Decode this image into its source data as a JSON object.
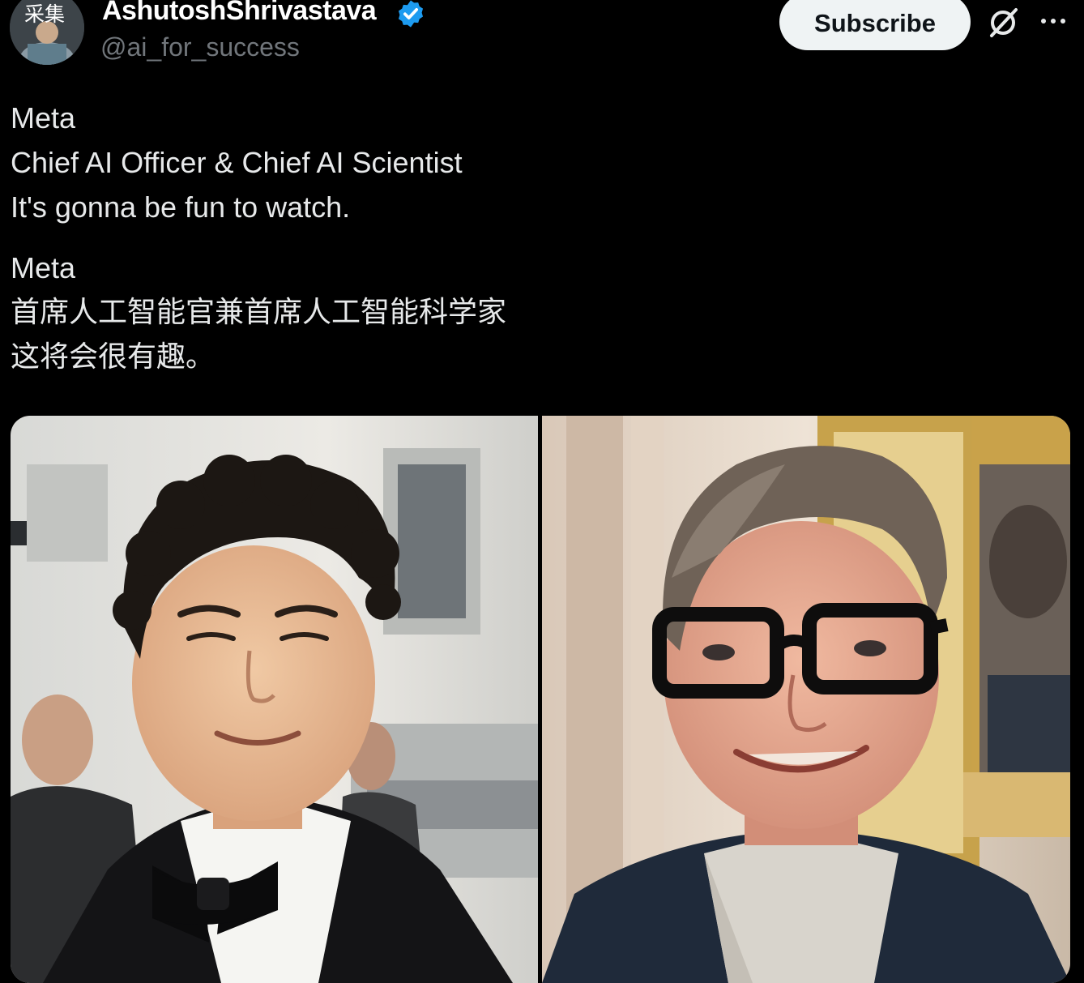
{
  "author": {
    "avatar_badge": "采集",
    "display_name": "AshutoshShrivastava",
    "handle": "@ai_for_success",
    "verified": true
  },
  "actions": {
    "subscribe_label": "Subscribe",
    "grok_icon": "grok-slash-icon",
    "more_icon": "more-dots-icon"
  },
  "tweet": {
    "paragraphs": [
      [
        "Meta",
        "Chief AI Officer & Chief AI Scientist",
        "It's gonna be fun to watch."
      ],
      [
        "Meta",
        "首席人工智能官兼首席人工智能科学家",
        "这将会很有趣。"
      ]
    ]
  },
  "media": {
    "images": [
      "young-man-tuxedo-bowtie-photo",
      "man-black-glasses-gold-frame-photo"
    ]
  },
  "colors": {
    "background": "#000000",
    "text": "#e7e9ea",
    "secondary_text": "#71767b",
    "verified": "#1d9bf0",
    "subscribe_bg": "#eff3f4"
  }
}
